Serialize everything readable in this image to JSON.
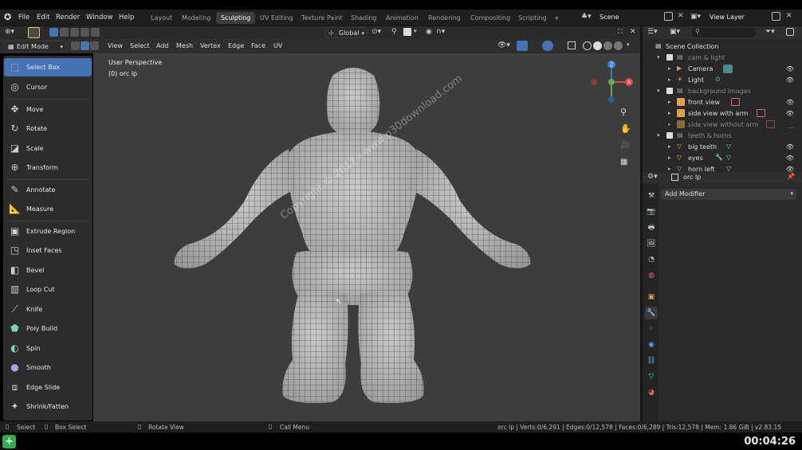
{
  "menubar": {
    "items": [
      "File",
      "Edit",
      "Render",
      "Window",
      "Help"
    ],
    "workspaces": [
      "Layout",
      "Modeling",
      "Sculpting",
      "UV Editing",
      "Texture Paint",
      "Shading",
      "Animation",
      "Rendering",
      "Compositing",
      "Scripting"
    ],
    "active_workspace": "Sculpting",
    "add_tab": "+",
    "scene": "Scene",
    "view_layer": "View Layer"
  },
  "viewport_header": {
    "transform_orientation": "Global",
    "mode": "Edit Mode",
    "menus": [
      "View",
      "Select",
      "Add",
      "Mesh",
      "Vertex",
      "Edge",
      "Face",
      "UV"
    ]
  },
  "viewport": {
    "perspective": "User Perspective",
    "object_info": "(0) orc lp",
    "watermark": "Copyright © 2017 - www.p30download.com",
    "gizmo": {
      "x": "X",
      "y": "Y",
      "z": "Z"
    }
  },
  "toolbar": {
    "tools": [
      {
        "label": "Select Box",
        "icon": "select-box-icon",
        "active": true
      },
      {
        "label": "Cursor",
        "icon": "cursor-icon"
      },
      {
        "label": "Move",
        "icon": "move-icon"
      },
      {
        "label": "Rotate",
        "icon": "rotate-icon"
      },
      {
        "label": "Scale",
        "icon": "scale-icon"
      },
      {
        "label": "Transform",
        "icon": "transform-icon"
      },
      {
        "label": "Annotate",
        "icon": "annotate-icon"
      },
      {
        "label": "Measure",
        "icon": "measure-icon"
      },
      {
        "label": "Extrude Region",
        "icon": "extrude-icon"
      },
      {
        "label": "Inset Faces",
        "icon": "inset-icon"
      },
      {
        "label": "Bevel",
        "icon": "bevel-icon"
      },
      {
        "label": "Loop Cut",
        "icon": "loop-cut-icon"
      },
      {
        "label": "Knife",
        "icon": "knife-icon"
      },
      {
        "label": "Poly Build",
        "icon": "poly-build-icon"
      },
      {
        "label": "Spin",
        "icon": "spin-icon"
      },
      {
        "label": "Smooth",
        "icon": "smooth-icon"
      },
      {
        "label": "Edge Slide",
        "icon": "edge-slide-icon"
      },
      {
        "label": "Shrink/Fatten",
        "icon": "shrink-fatten-icon"
      }
    ]
  },
  "outliner": {
    "search_placeholder": "",
    "root": "Scene Collection",
    "rows": [
      {
        "label": "cam & light",
        "level": 1,
        "type": "collection",
        "dim": true
      },
      {
        "label": "Camera",
        "level": 2,
        "type": "camera"
      },
      {
        "label": "Light",
        "level": 2,
        "type": "light"
      },
      {
        "label": "background images",
        "level": 1,
        "type": "collection",
        "dim": true
      },
      {
        "label": "front view",
        "level": 2,
        "type": "image"
      },
      {
        "label": "side view with arm",
        "level": 2,
        "type": "image"
      },
      {
        "label": "side view without arm",
        "level": 2,
        "type": "image",
        "dim": true
      },
      {
        "label": "teeth & horns",
        "level": 1,
        "type": "collection",
        "dim": true
      },
      {
        "label": "big teeth",
        "level": 2,
        "type": "mesh"
      },
      {
        "label": "eyes",
        "level": 2,
        "type": "mesh"
      },
      {
        "label": "horn left",
        "level": 2,
        "type": "mesh"
      }
    ]
  },
  "properties": {
    "object_name": "orc lp",
    "add_modifier": "Add Modifier"
  },
  "statusbar": {
    "select": "Select",
    "box_select": "Box Select",
    "rotate_view": "Rotate View",
    "call_menu": "Call Menu",
    "stats": "orc lp | Verts:0/6,291 | Edges:0/12,578 | Faces:0/6,289 | Tris:12,578 | Mem: 1.86 GiB | v2.83.15"
  },
  "player": {
    "time": "00:04:26"
  },
  "colors": {
    "accent": "#4772b3",
    "axis_x": "#e04848",
    "axis_y": "#6aa84f",
    "axis_z": "#3a7bd5"
  }
}
